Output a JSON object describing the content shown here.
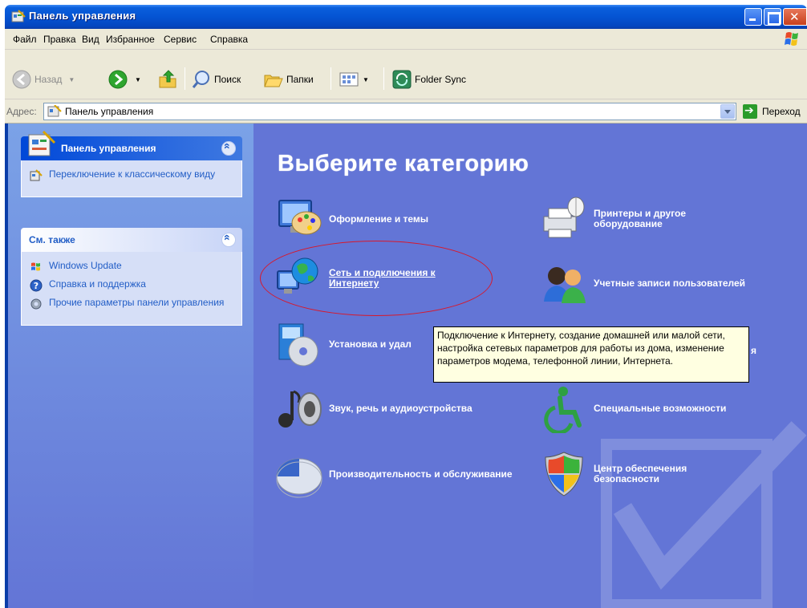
{
  "window": {
    "title": "Панель управления"
  },
  "menu": [
    "Файл",
    "Правка",
    "Вид",
    "Избранное",
    "Сервис",
    "Справка"
  ],
  "toolbar": {
    "back": "Назад",
    "search": "Поиск",
    "folders": "Папки",
    "folder_sync": "Folder Sync"
  },
  "address": {
    "label": "Адрес:",
    "value": "Панель управления",
    "go": "Переход"
  },
  "task_pane": {
    "control_panel": {
      "title": "Панель управления",
      "items": [
        {
          "label": "Переключение к классическому виду",
          "icon": "classic-view-icon"
        }
      ]
    },
    "see_also": {
      "title": "См. также",
      "items": [
        {
          "label": "Windows Update",
          "icon": "windows-update-icon"
        },
        {
          "label": "Справка и поддержка",
          "icon": "help-icon"
        },
        {
          "label": "Прочие параметры панели управления",
          "icon": "gear-icon"
        }
      ]
    }
  },
  "main": {
    "heading": "Выберите категорию",
    "categories": [
      {
        "label": "Оформление и темы",
        "icon": "appearance-themes-icon"
      },
      {
        "label": "Принтеры и другое оборудование",
        "icon": "printers-icon"
      },
      {
        "label": "Сеть и подключения к Интернету",
        "icon": "network-globe-icon"
      },
      {
        "label": "Учетные записи пользователей",
        "icon": "user-accounts-icon"
      },
      {
        "label": "Установка и удал",
        "icon": "add-remove-programs-icon"
      },
      {
        "label": "Звук, речь и аудиоустройства",
        "icon": "sound-icon"
      },
      {
        "label": "Специальные возможности",
        "icon": "accessibility-icon"
      },
      {
        "label": "Производительность и обслуживание",
        "icon": "performance-icon"
      },
      {
        "label": "Центр обеспечения безопасности",
        "icon": "security-shield-icon"
      }
    ],
    "tooltip": "Подключение к Интернету, создание домашней или малой сети, настройка сетевых параметров для работы из дома, изменение параметров модема, телефонной линии, Интернета.",
    "tooltip_partial_letter": "я"
  },
  "colors": {
    "titlebar": "#0454d3",
    "taskpane_top": "#7ba2e7",
    "main_bg": "#6375d6",
    "link": "#215dc6",
    "highlight_ellipse": "#d8182b",
    "tooltip_bg": "#ffffe1"
  }
}
